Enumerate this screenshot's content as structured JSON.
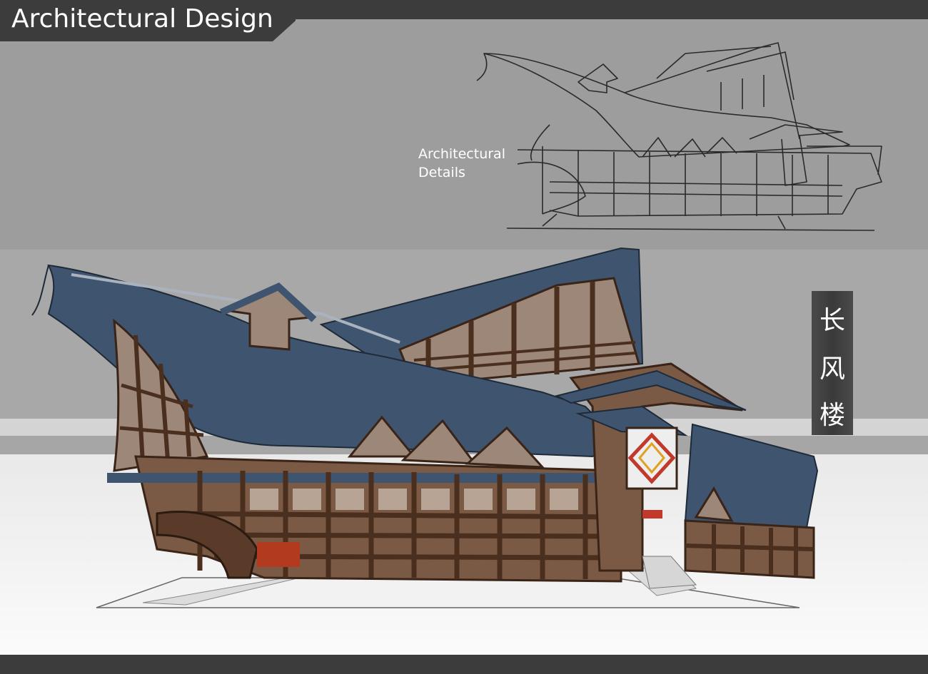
{
  "page": {
    "title": "Architectural Design",
    "detail_label_line1": "Architectural",
    "detail_label_line2": "Details",
    "building_name_chars": [
      "长",
      "风",
      "楼"
    ]
  },
  "colors": {
    "header": "#3c3c3c",
    "roof": "#3f556f",
    "timber": "#4a2e1e",
    "wall": "#9c8778",
    "lantern_accent": "#c0392b"
  }
}
